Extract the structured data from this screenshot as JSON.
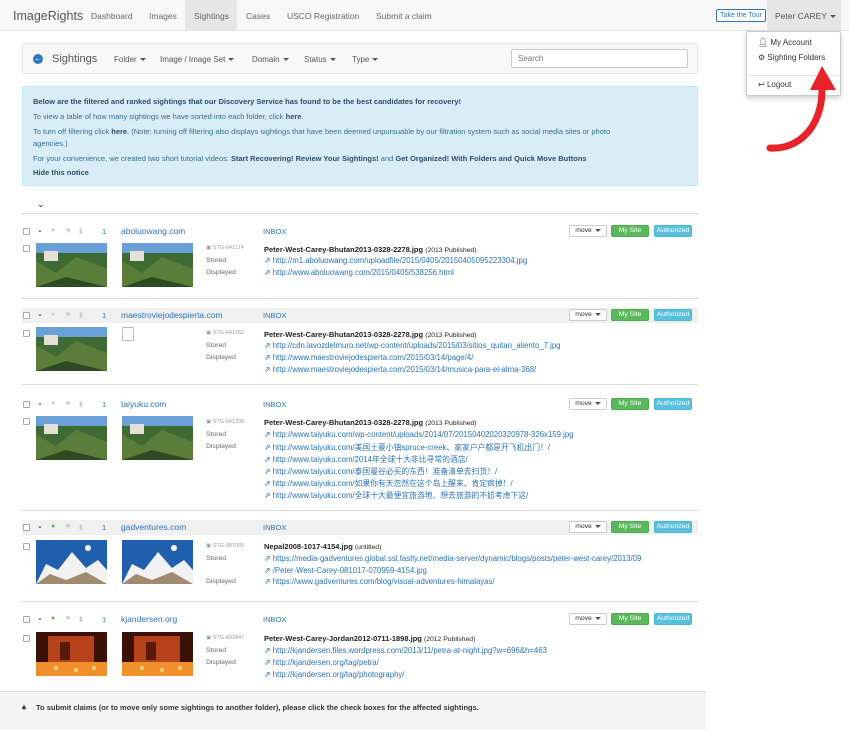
{
  "nav": {
    "brand": "ImageRights",
    "items": [
      "Dashboard",
      "Images",
      "Sightings",
      "Cases",
      "USCO Registration",
      "Submit a claim"
    ],
    "tour": "Take the Tour",
    "user": "Peter CAREY"
  },
  "dropdown": {
    "account": "My Account",
    "folders": "Sighting Folders",
    "logout": "Logout"
  },
  "toolbar": {
    "title": "Sightings",
    "filters": [
      "Folder",
      "Image / Image Set",
      "Domain",
      "Status",
      "Type"
    ],
    "search_placeholder": "Search"
  },
  "notice": {
    "l1": "Below are the filtered and ranked sightings that our Discovery Service has found to be the best candidates for recovery!",
    "l2a": "To view a table of how many sightings we have sorted into each folder, click ",
    "l2b": "here",
    "l3a": "To turn off filtering click ",
    "l3b": "here",
    "l3c": ". (Note: turning off filtering also displays sightings that have been deemed unpursuable by our filtration system such as social media sites or photo",
    "l4": "agencies.)",
    "l5a": "For your convenience, we created two short tutorial videos: ",
    "l5b": "Start Recovering! Review Your Sightings!",
    "l5c": " and ",
    "l5d": "Get Organized! With Folders and Quick Move Buttons",
    "l6": "Hide this notice"
  },
  "buttons": {
    "move": "move",
    "site": "My Site",
    "auth": "Authorized"
  },
  "labels": {
    "stored": "Stored",
    "displayed": "Displayed"
  },
  "rows": [
    {
      "num": "1",
      "domain": "aboluowang.com",
      "folder": "INBOX",
      "stg": "STG-641174",
      "title": "Peter-West-Carey-Bhutan2013-0328-2278.jpg",
      "note": "(2013 Published)",
      "links": [
        "http://m1.aboluowang.com/uploadfile/2015/0405/20150405095223304.jpg",
        "http://www.aboluowang.com/2015/0405/538256.html"
      ]
    },
    {
      "num": "1",
      "domain": "maestroviejodespierta.com",
      "folder": "INBOX",
      "stg": "STG-641262",
      "title": "Peter-West-Carey-Bhutan2013-0328-2278.jpg",
      "note": "(2013 Published)",
      "links": [
        "http://cdn.lavozdelmuro.net/wp-content/uploads/2015/03/sitios_quitan_aliento_7.jpg",
        "http://www.maestroviejodespierta.com/2015/03/14/page/4/",
        "http://www.maestroviejodespierta.com/2015/03/14/musica-para-el-alma-368/"
      ]
    },
    {
      "num": "1",
      "domain": "taiyuku.com",
      "folder": "INBOX",
      "stg": "STG-641338",
      "title": "Peter-West-Carey-Bhutan2013-0328-2278.jpg",
      "note": "(2013 Published)",
      "links": [
        "http://www.taiyuku.com/wp-content/uploads/2014/07/20150402020320978-326x159.jpg",
        "http://www.taiyuku.com/美国土豪小镇spruce-creek、家家户户都是开飞机出门！/",
        "http://www.taiyuku.com/2014年全球十大非比寻常的酒店/",
        "http://www.taiyuku.com/泰国曼谷必买的东西！准备清单去扫货！/",
        "http://www.taiyuku.com/如果你有天忽然在这个岛上醒来、肯定疯掉！/",
        "http://www.taiyuku.com/全球十大最便宜旅游地、想去旅游的不妨考虑下这/"
      ]
    },
    {
      "num": "1",
      "domain": "gadventures.com",
      "folder": "INBOX",
      "stg": "STG-997005",
      "title": "Nepal2008-1017-4154.jpg",
      "note": "(untitled)",
      "links": [
        "https://media-gadventures.global.ssl.fastly.net/media-server/dynamic/blogs/posts/peter-west-carey/2013/09",
        "/Peter-West-Carey-081017-070959-4154.jpg",
        "https://www.gadventures.com/blog/visual-adventures-himalayas/"
      ]
    },
    {
      "num": "1",
      "domain": "kjandersen.org",
      "folder": "INBOX",
      "stg": "STG-693447",
      "title": "Peter-West-Carey-Jordan2012-0711-1898.jpg",
      "note": "(2012 Published)",
      "links": [
        "http://kjandersen.files.wordpress.com/2013/11/petra-at-night.jpg?w=696&h=463",
        "http://kjandersen.org/tag/petra/",
        "http://kjandersen.org/tag/photography/"
      ]
    }
  ],
  "footer": "To submit claims (or to move only some sightings to another folder), please click the check boxes for the affected sightings."
}
